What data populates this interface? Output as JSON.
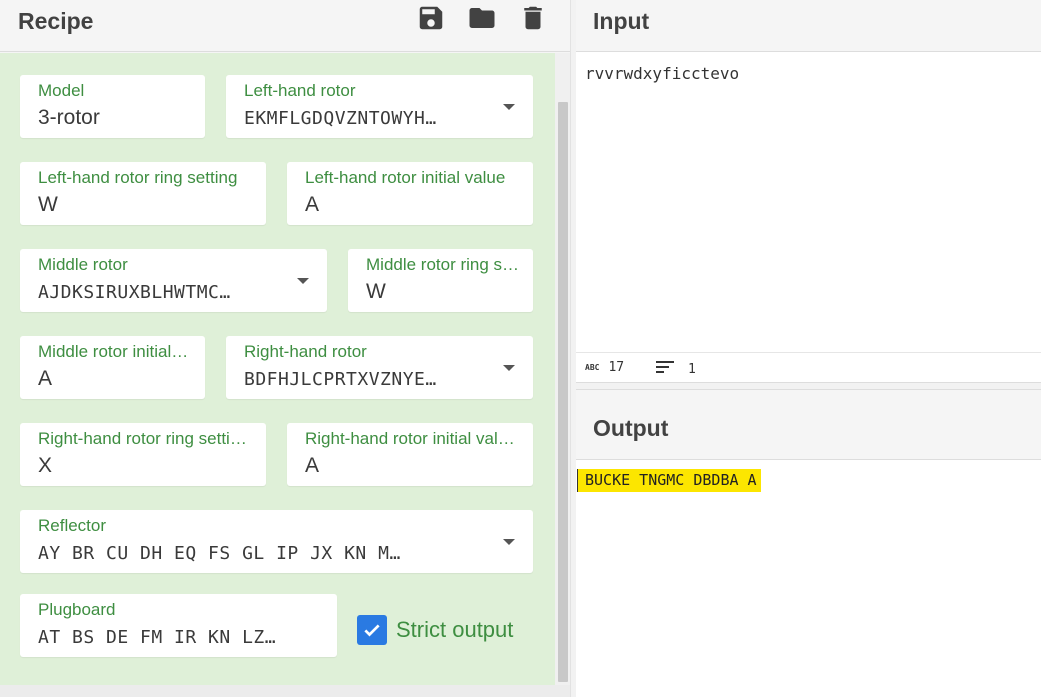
{
  "recipe": {
    "title": "Recipe",
    "icons": {
      "save": "save-icon",
      "load": "folder-icon",
      "clear": "trash-icon"
    },
    "fields": {
      "model": {
        "label": "Model",
        "value": "3-rotor"
      },
      "left_rotor": {
        "label": "Left-hand rotor",
        "value": "EKMFLGDQVZNTOWYH…"
      },
      "left_ring": {
        "label": "Left-hand rotor ring setting",
        "value": "W"
      },
      "left_initial": {
        "label": "Left-hand rotor initial value",
        "value": "A"
      },
      "middle_rotor": {
        "label": "Middle rotor",
        "value": "AJDKSIRUXBLHWTMC…"
      },
      "middle_ring": {
        "label": "Middle rotor ring s…",
        "value": "W"
      },
      "middle_initial": {
        "label": "Middle rotor initial…",
        "value": "A"
      },
      "right_rotor": {
        "label": "Right-hand rotor",
        "value": "BDFHJLCPRTXVZNYE…"
      },
      "right_ring": {
        "label": "Right-hand rotor ring setti…",
        "value": "X"
      },
      "right_initial": {
        "label": "Right-hand rotor initial val…",
        "value": "A"
      },
      "reflector": {
        "label": "Reflector",
        "value": "AY BR CU DH EQ FS GL IP JX KN M…"
      },
      "plugboard": {
        "label": "Plugboard",
        "value": "AT BS DE FM IR KN LZ…"
      }
    },
    "strict_output": {
      "label": "Strict output",
      "checked": true
    }
  },
  "input": {
    "title": "Input",
    "text": "rvvrwdxyficctevo",
    "length_icon_text": "ABC",
    "length": "17",
    "lines": "1"
  },
  "output": {
    "title": "Output",
    "text": "BUCKE TNGMC DBDBA A"
  },
  "colors": {
    "recipe_bg": "#dff0d8",
    "label_green": "#3e8e41",
    "checkbox_blue": "#2a7ae2",
    "output_highlight": "#fce600"
  }
}
